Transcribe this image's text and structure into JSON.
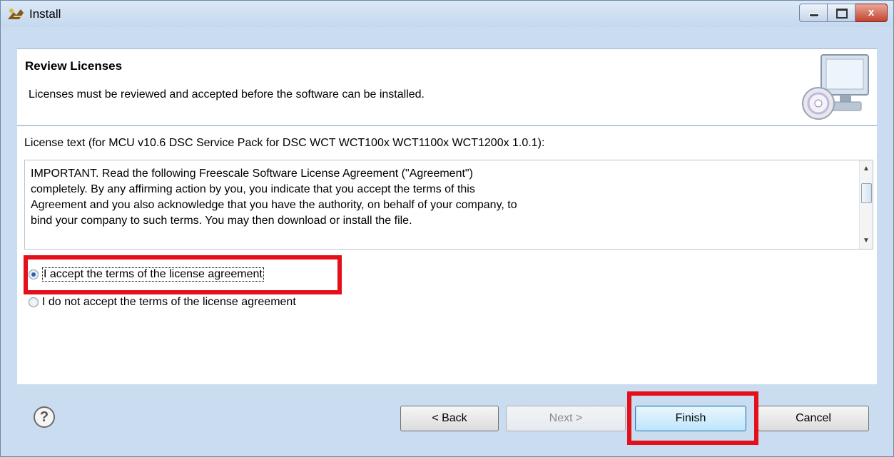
{
  "window": {
    "title": "Install"
  },
  "header": {
    "title": "Review Licenses",
    "description": "Licenses must be reviewed and accepted before the software can be installed.",
    "image_icon": "computer-cd-icon"
  },
  "license": {
    "label": "License text (for MCU v10.6 DSC Service Pack for DSC WCT WCT100x WCT1100x WCT1200x 1.0.1):",
    "text": "IMPORTANT. Read the following Freescale Software License Agreement (\"Agreement\")\ncompletely. By any affirming action by you, you indicate that you accept the terms of this\nAgreement and you also acknowledge that you have the authority, on behalf of your company, to\nbind your company to such terms.  You may then download or install the file."
  },
  "options": {
    "accept_label": "I accept the terms of the license agreement",
    "decline_label": "I do not accept the terms of the license agreement",
    "selected": "accept"
  },
  "buttons": {
    "back": "< Back",
    "next": "Next >",
    "finish": "Finish",
    "cancel": "Cancel"
  },
  "icons": {
    "help": "?",
    "close": "x"
  },
  "colors": {
    "highlight": "#e3101b",
    "title_bar": "#c5d8ee",
    "accent": "#2a63a8"
  }
}
